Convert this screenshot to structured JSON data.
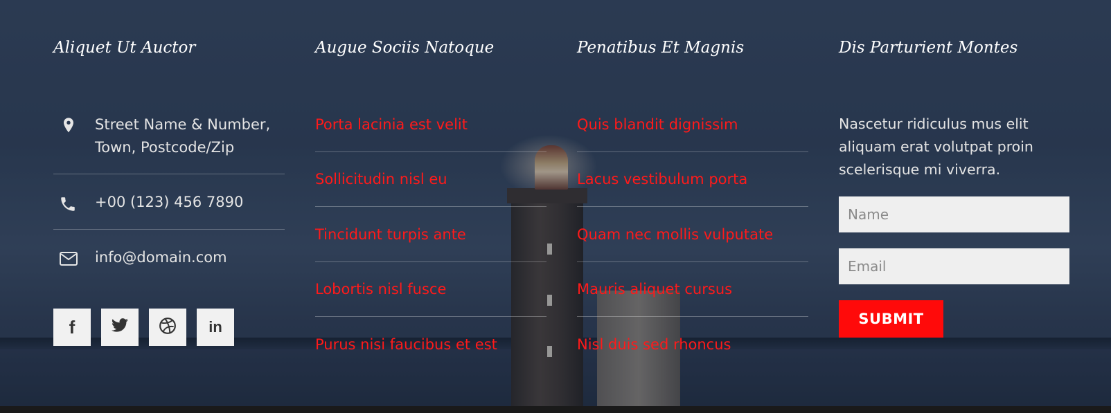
{
  "columns": [
    {
      "title": "Aliquet Ut Auctor"
    },
    {
      "title": "Augue Sociis Natoque"
    },
    {
      "title": "Penatibus Et Magnis"
    },
    {
      "title": "Dis Parturient Montes"
    }
  ],
  "contact": {
    "address_line1": "Street Name & Number,",
    "address_line2": "Town, Postcode/Zip",
    "phone": "+00 (123) 456 7890",
    "email": "info@domain.com",
    "icons": [
      "map-pin-icon",
      "phone-icon",
      "envelope-icon"
    ]
  },
  "social": [
    {
      "icon": "facebook-icon",
      "glyph": "f"
    },
    {
      "icon": "twitter-icon",
      "glyph": ""
    },
    {
      "icon": "dribbble-icon",
      "glyph": ""
    },
    {
      "icon": "linkedin-icon",
      "glyph": "in"
    }
  ],
  "links_col2": [
    "Porta lacinia est velit",
    "Sollicitudin nisl eu",
    "Tincidunt turpis ante",
    "Lobortis nisl fusce",
    "Purus nisi faucibus et est"
  ],
  "links_col3": [
    "Quis blandit dignissim",
    "Lacus vestibulum porta",
    "Quam nec mollis vulputate",
    "Mauris aliquet cursus",
    "Nisl duis sed rhoncus"
  ],
  "newsletter": {
    "description": "Nascetur ridiculus mus elit aliquam erat volutpat proin scelerisque mi viverra.",
    "name_placeholder": "Name",
    "email_placeholder": "Email",
    "submit_label": "SUBMIT"
  },
  "colors": {
    "link": "#ff1a1a",
    "button": "#ff0a0a",
    "heading": "#ffffff"
  }
}
